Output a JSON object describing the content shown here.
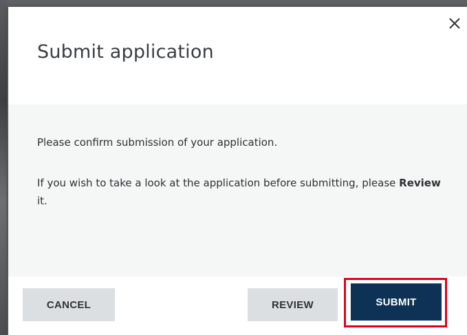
{
  "dialog": {
    "title": "Submit application",
    "close_icon": "close-icon",
    "body": {
      "line1": "Please confirm submission of your application.",
      "line2_prefix": "If you wish to take a look at the application before submitting, please ",
      "line2_bold": "Review",
      "line2_suffix": " it."
    },
    "buttons": {
      "cancel_label": "CANCEL",
      "review_label": "REVIEW",
      "submit_label": "SUBMIT"
    }
  },
  "colors": {
    "submit_bg": "#0e3256",
    "secondary_bg": "#dcdfe1",
    "highlight": "#e0001b",
    "body_bg": "#f5f6f6"
  }
}
